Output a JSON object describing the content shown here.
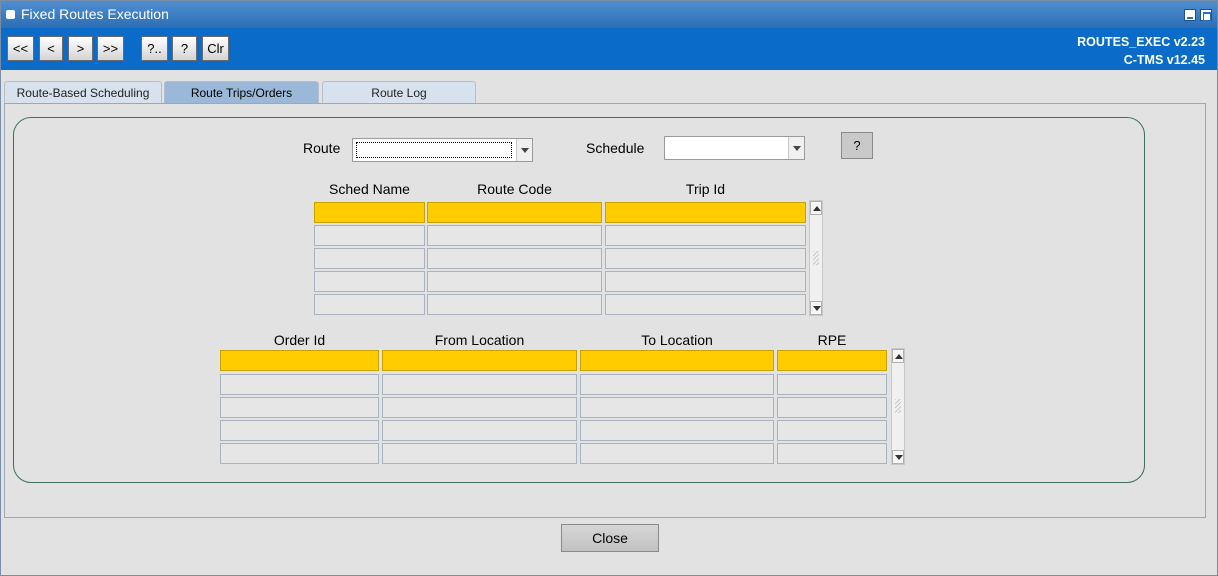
{
  "window": {
    "title": "Fixed Routes Execution"
  },
  "toolbar": {
    "buttons": [
      "<<",
      "<",
      ">",
      ">>",
      "?..",
      "?",
      "Clr"
    ],
    "version_app": "ROUTES_EXEC v2.23",
    "version_platform": "C-TMS v12.45"
  },
  "tabs": [
    {
      "label": "Route-Based Scheduling",
      "active": false
    },
    {
      "label": "Route Trips/Orders",
      "active": true
    },
    {
      "label": "Route Log",
      "active": false
    }
  ],
  "filters": {
    "route_label": "Route",
    "route_value": "",
    "schedule_label": "Schedule",
    "schedule_value": "",
    "help_button": "?"
  },
  "trips_table": {
    "columns": [
      "Sched Name",
      "Route Code",
      "Trip Id"
    ],
    "rows": [
      [
        "",
        "",
        ""
      ],
      [
        "",
        "",
        ""
      ],
      [
        "",
        "",
        ""
      ],
      [
        "",
        "",
        ""
      ],
      [
        "",
        "",
        ""
      ]
    ],
    "selected_row": 0
  },
  "orders_table": {
    "columns": [
      "Order Id",
      "From Location",
      "To Location",
      "RPE"
    ],
    "rows": [
      [
        "",
        "",
        "",
        ""
      ],
      [
        "",
        "",
        "",
        ""
      ],
      [
        "",
        "",
        "",
        ""
      ],
      [
        "",
        "",
        "",
        ""
      ],
      [
        "",
        "",
        "",
        ""
      ]
    ],
    "selected_row": 0
  },
  "footer": {
    "close_label": "Close"
  },
  "colors": {
    "toolbar": "#0a6cc8",
    "title_bar": "#2d6db5",
    "selected_row": "#ffcc00",
    "active_tab": "#9bb8d8"
  }
}
